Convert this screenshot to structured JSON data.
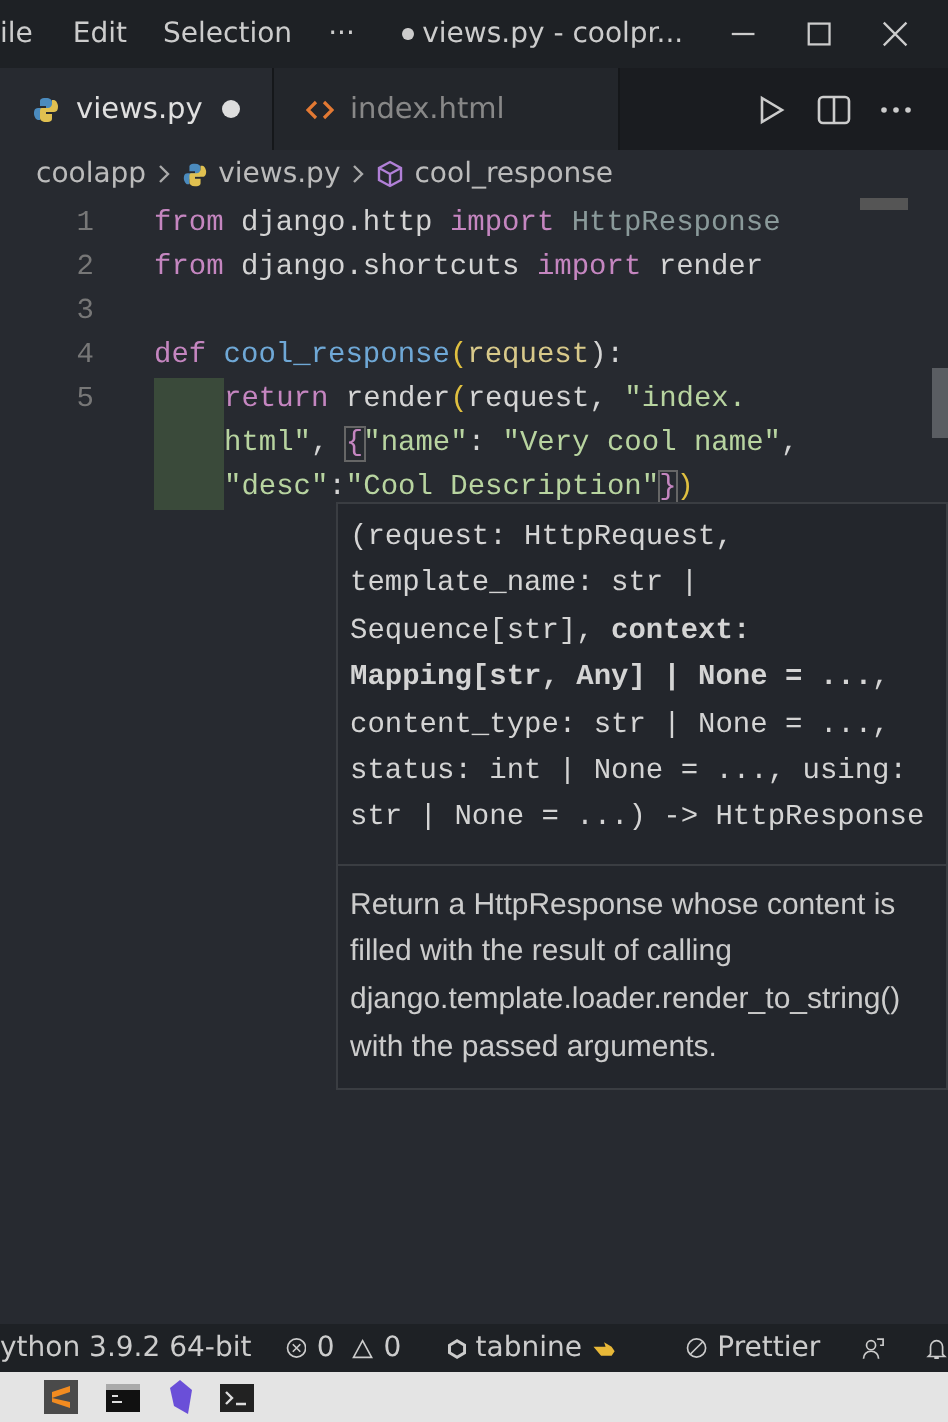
{
  "menu": [
    "ile",
    "Edit",
    "Selection",
    "···"
  ],
  "window": {
    "title": "views.py - coolpr...",
    "modified": true
  },
  "tabs": [
    {
      "label": "views.py",
      "selected": true,
      "modified": true
    },
    {
      "label": "index.html",
      "selected": false,
      "modified": false
    }
  ],
  "breadcrumb": [
    "coolapp",
    "views.py",
    "cool_response"
  ],
  "code": {
    "lines": [
      {
        "number": "1",
        "tokens": [
          {
            "kind": "keyword",
            "text": "from"
          },
          {
            "kind": "plain",
            "text": " django.http "
          },
          {
            "kind": "keyword",
            "text": "import"
          },
          {
            "kind": "class",
            "text": " HttpResponse"
          }
        ]
      },
      {
        "number": "2",
        "tokens": [
          {
            "kind": "keyword",
            "text": "from"
          },
          {
            "kind": "plain",
            "text": " django.shortcuts "
          },
          {
            "kind": "keyword",
            "text": "import"
          },
          {
            "kind": "plain",
            "text": " render"
          }
        ]
      },
      {
        "number": "3"
      },
      {
        "number": "4",
        "tokens": [
          {
            "kind": "keyword",
            "text": "def"
          },
          {
            "kind": "func",
            "text": " cool_response"
          },
          {
            "kind": "brace",
            "text": "("
          },
          {
            "kind": "param",
            "text": "request"
          },
          {
            "kind": "plain",
            "text": "):"
          }
        ]
      },
      {
        "number": "5",
        "indent": true,
        "tokens": [
          {
            "kind": "keyword",
            "text": "return"
          },
          {
            "kind": "plain",
            "text": " render"
          },
          {
            "kind": "brace",
            "text": "("
          },
          {
            "kind": "plain",
            "text": "request, "
          },
          {
            "kind": "string",
            "text": "\"index."
          }
        ]
      },
      {
        "indent": true,
        "tokens": [
          {
            "kind": "string",
            "text": "html\""
          },
          {
            "kind": "plain",
            "text": ", "
          },
          {
            "kind": "match",
            "text": "{"
          },
          {
            "kind": "string",
            "text": "\"name\""
          },
          {
            "kind": "plain",
            "text": ": "
          },
          {
            "kind": "string",
            "text": "\"Very cool name\""
          },
          {
            "kind": "plain",
            "text": ","
          }
        ]
      },
      {
        "indent": true,
        "tokens": [
          {
            "kind": "string",
            "text": "\"desc\""
          },
          {
            "kind": "plain",
            "text": ":"
          },
          {
            "kind": "string",
            "text": "\"Cool Description\""
          },
          {
            "kind": "match",
            "text": "}"
          },
          {
            "kind": "brace",
            "text": ")"
          }
        ]
      }
    ]
  },
  "hover": {
    "signature": [
      "(request: HttpRequest,",
      "template_name: str |",
      "Sequence[str], **context:**",
      "**Mapping[str, Any] | None = ...**,",
      "content_type: str | None = ...,",
      "status: int | None = ..., using:",
      "str | None = ...) -> HttpResponse"
    ],
    "doc": "Return a HttpResponse whose content is filled with the result of calling django.template.loader.render_to_string() with the passed arguments."
  },
  "status_bar": {
    "interpreter": "ython 3.9.2 64-bit",
    "errors": "0",
    "warnings": "0",
    "tabnine": "tabnine",
    "prettier": "Prettier"
  },
  "taskbar": [
    {
      "kind": "sublime"
    },
    {
      "kind": "terminal"
    },
    {
      "kind": "crystal"
    },
    {
      "kind": "console"
    }
  ]
}
